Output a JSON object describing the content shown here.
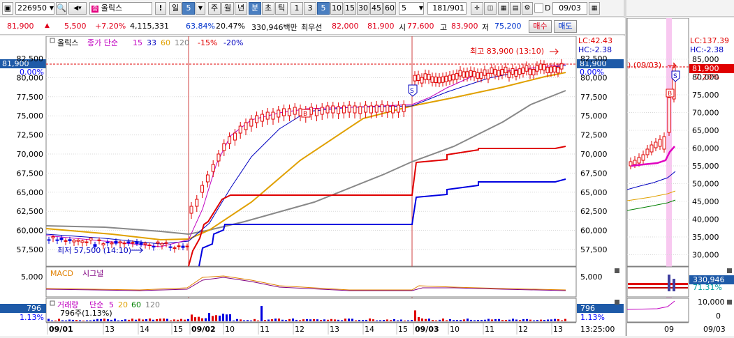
{
  "toolbar": {
    "stock_code": "226950",
    "stock_name": "올릭스",
    "excl": "!",
    "periods": [
      "일",
      "5",
      "주",
      "월",
      "년",
      "분",
      "초",
      "틱",
      "1",
      "3",
      "5",
      "10",
      "15",
      "30",
      "45",
      "60"
    ],
    "period_count": "5",
    "page_indicator": "181",
    "page_total": "/901",
    "date_checkbox_label": "D",
    "date_value": "09/03",
    "colors": {
      "selected": "#4a7fc1"
    }
  },
  "info": {
    "price": "81,900",
    "change": "5,500",
    "change_pct": "+7.20%",
    "volume": "4,115,331",
    "ratio1": "63.84%",
    "ratio2": "20.47%",
    "amount": "330,946백만",
    "best_label": "최우선",
    "best_ask": "82,000",
    "best_bid": "81,900",
    "open_label": "시",
    "open": "77,600",
    "high_label": "고",
    "high": "83,900",
    "low_label": "저",
    "low": "75,200",
    "buy_label": "매수",
    "sell_label": "매도"
  },
  "legend": {
    "name": "올릭스",
    "ma_text": "종가 단순",
    "ma1": "15",
    "ma2": "33",
    "ma3": "60",
    "ma4": "120",
    "pct1": "-15%",
    "pct2": "-20%",
    "colors": {
      "ma1": "#c000c0",
      "ma2": "#0000c0",
      "ma3": "#e0a000",
      "ma4": "#808080"
    }
  },
  "annotations": {
    "high_text": "최고 83,900 (13:10)",
    "low_text": "최저 57,500 (14:10)",
    "lc": "LC:42.43",
    "hc": "HC:-2.38",
    "current_price": "81,900",
    "current_pct": "0.00%",
    "sell_marker": "S",
    "buy_marker": "B"
  },
  "price_axis": [
    "82,500",
    "80,000",
    "77,500",
    "75,000",
    "72,500",
    "70,000",
    "67,500",
    "65,000",
    "62,500",
    "60,000",
    "57,500"
  ],
  "macd": {
    "label": "MACD",
    "signal": "시그널",
    "axis": "5,000"
  },
  "volume_panel": {
    "label": "거래량",
    "ma_text": "단순",
    "ma1": "5",
    "ma2": "20",
    "ma3": "60",
    "ma4": "120",
    "sub": "796주(1.13%)",
    "value": "796",
    "pct": "1.13%"
  },
  "time_axis": [
    "09/01",
    "13",
    "14",
    "15",
    "09/02",
    "10",
    "11",
    "12",
    "13",
    "14",
    "15",
    "09/03",
    "10",
    "11",
    "12",
    "13"
  ],
  "time_now": "13:25:00",
  "side": {
    "lc": "LC:137.39",
    "hc": "HC:-2.38",
    "cut_label": ") (09/03)",
    "price": "81,900",
    "pct": "7.20%",
    "axis": [
      "85,000",
      "80,000",
      "75,000",
      "70,000",
      "65,000",
      "60,000",
      "55,000",
      "50,000",
      "45,000",
      "40,000",
      "35,000",
      "30,000"
    ],
    "vol": "330,946",
    "vol_pct": "71.31%",
    "vol_axis": "10,000",
    "vol_zero": "0",
    "time_label": "09",
    "date_label": "09/03"
  }
}
